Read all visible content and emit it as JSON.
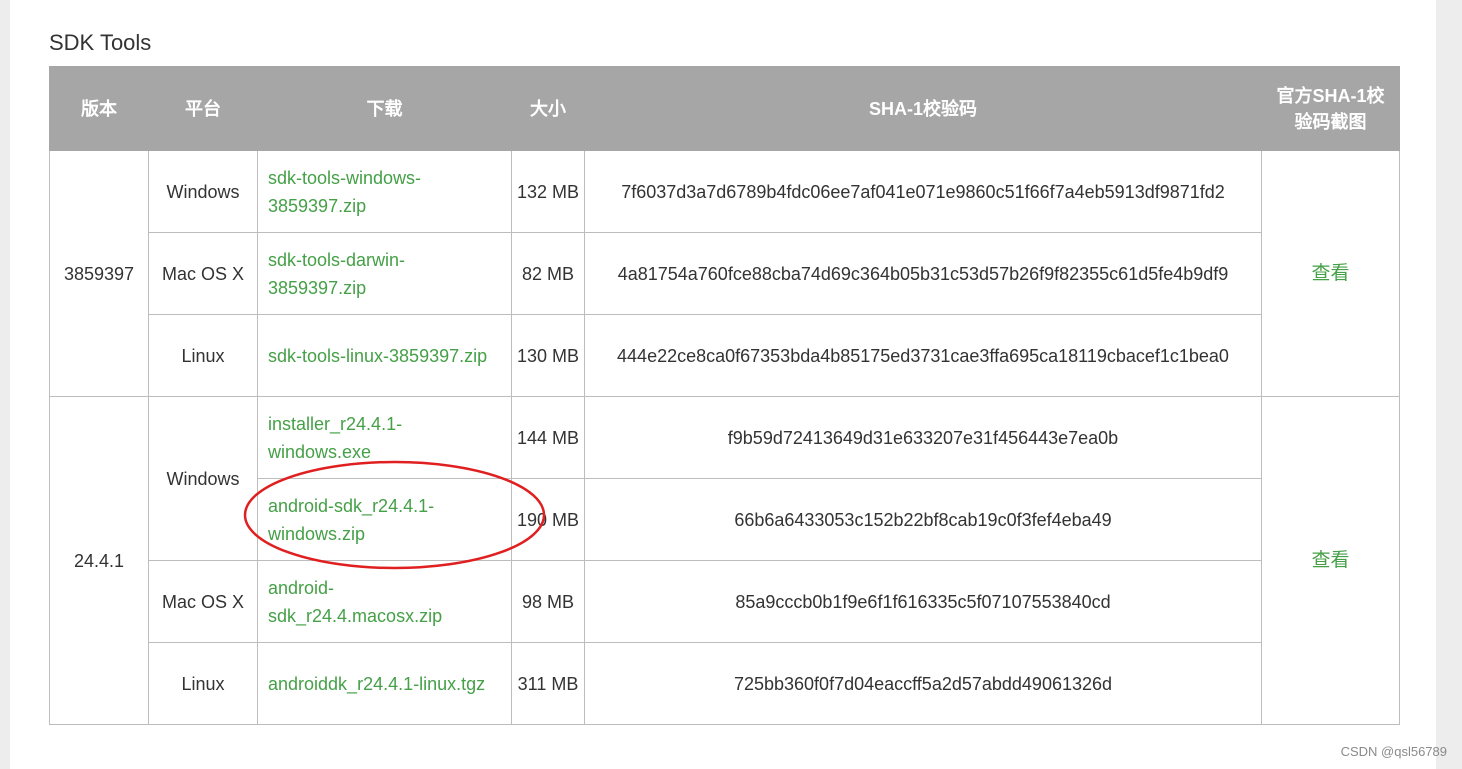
{
  "section": {
    "title": "SDK Tools"
  },
  "table": {
    "headers": {
      "version": "版本",
      "platform": "平台",
      "download": "下载",
      "size": "大小",
      "sha1": "SHA-1校验码",
      "screenshot": "官方SHA-1校验码截图"
    },
    "groups": [
      {
        "version": "3859397",
        "view": "查看",
        "rows": [
          {
            "platform": "Windows",
            "file": "sdk-tools-windows-3859397.zip",
            "size": "132 MB",
            "sha1": "7f6037d3a7d6789b4fdc06ee7af041e071e9860c51f66f7a4eb5913df9871fd2"
          },
          {
            "platform": "Mac OS X",
            "file": "sdk-tools-darwin-3859397.zip",
            "size": "82 MB",
            "sha1": "4a81754a760fce88cba74d69c364b05b31c53d57b26f9f82355c61d5fe4b9df9"
          },
          {
            "platform": "Linux",
            "file": "sdk-tools-linux-3859397.zip",
            "size": "130 MB",
            "sha1": "444e22ce8ca0f67353bda4b85175ed3731cae3ffa695ca18119cbacef1c1bea0"
          }
        ]
      },
      {
        "version": "24.4.1",
        "view": "查看",
        "rows": [
          {
            "platform": "Windows",
            "file": "installer_r24.4.1-windows.exe",
            "size": "144 MB",
            "sha1": "f9b59d72413649d31e633207e31f456443e7ea0b"
          },
          {
            "platform": "",
            "file": "android-sdk_r24.4.1-windows.zip",
            "size": "190 MB",
            "sha1": "66b6a6433053c152b22bf8cab19c0f3fef4eba49"
          },
          {
            "platform": "Mac OS X",
            "file": "android-sdk_r24.4.macosx.zip",
            "size": "98 MB",
            "sha1": "85a9cccb0b1f9e6f1f616335c5f07107553840cd"
          },
          {
            "platform": "Linux",
            "file": "androiddk_r24.4.1-linux.tgz",
            "size": "311 MB",
            "sha1": "725bb360f0f7d04eaccff5a2d57abdd49061326d"
          }
        ]
      }
    ]
  },
  "annotation": {
    "shape": "ellipse",
    "color": "#e02020"
  },
  "watermark": {
    "text": "CSDN @qsl56789"
  },
  "colors": {
    "header_bg": "#a6a6a6",
    "link": "#45a047",
    "border": "#bdbdbd",
    "annotation": "#e02020"
  }
}
